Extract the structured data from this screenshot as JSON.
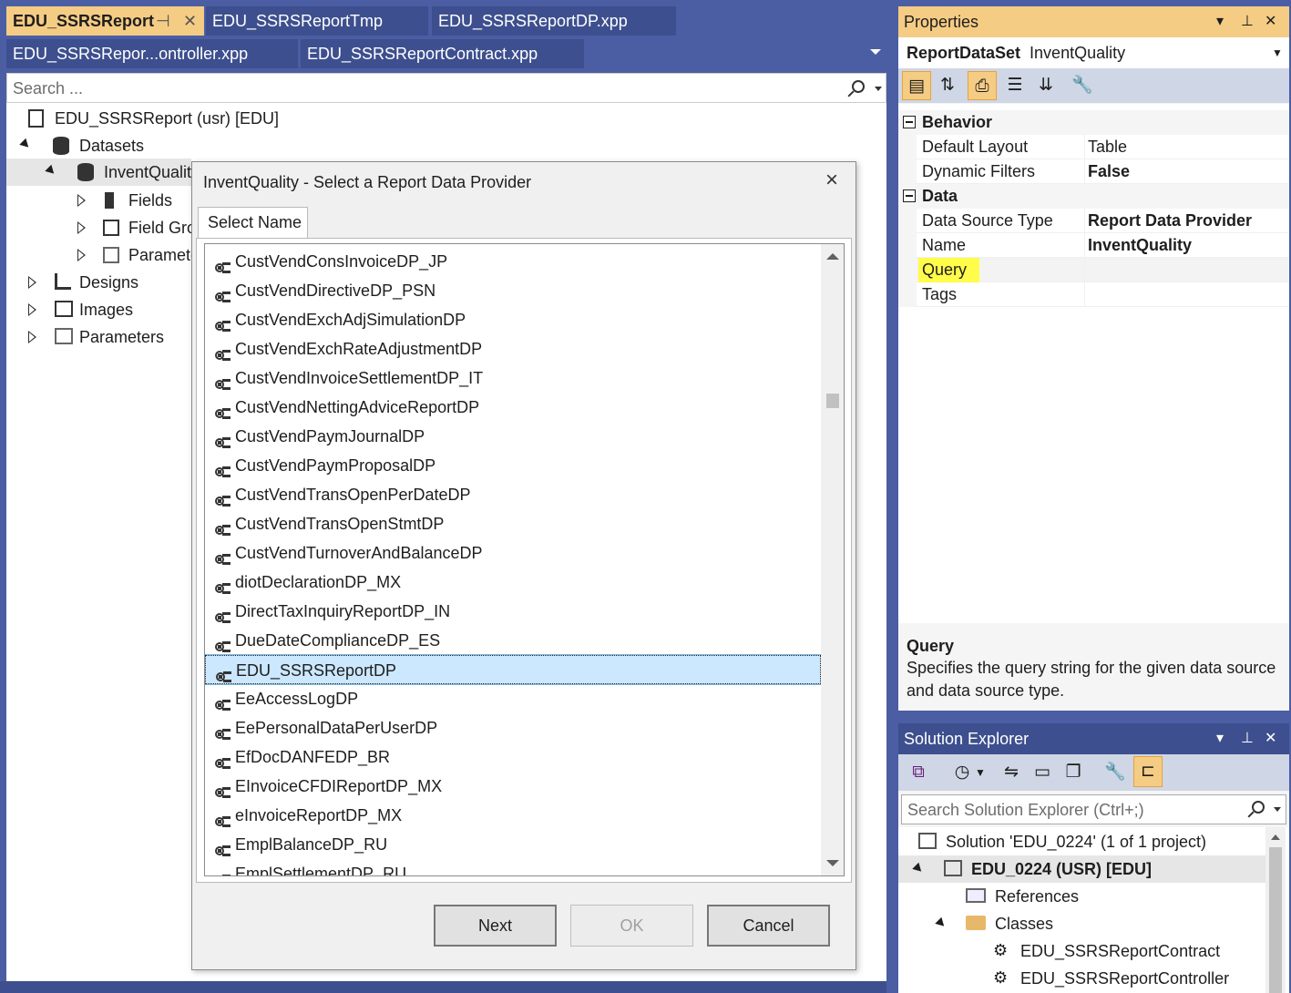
{
  "tabs": [
    {
      "label": "EDU_SSRSReport",
      "active": true
    },
    {
      "label": "EDU_SSRSReportTmp",
      "active": false
    },
    {
      "label": "EDU_SSRSReportDP.xpp",
      "active": false
    },
    {
      "label": "EDU_SSRSRepor...ontroller.xpp",
      "active": false
    },
    {
      "label": "EDU_SSRSReportContract.xpp",
      "active": false
    }
  ],
  "designer": {
    "search_placeholder": "Search ...",
    "tree": {
      "root": "EDU_SSRSReport (usr) [EDU]",
      "datasets": "Datasets",
      "dataset_item": "InventQualit",
      "fields": "Fields",
      "field_groups": "Field Gro",
      "parameters_child": "Paramete",
      "designs": "Designs",
      "images": "Images",
      "parameters": "Parameters"
    }
  },
  "dialog": {
    "title": "InventQuality - Select a Report Data Provider",
    "tab_label": "Select Name",
    "items": [
      "CustVendConsInvoiceDP_JP",
      "CustVendDirectiveDP_PSN",
      "CustVendExchAdjSimulationDP",
      "CustVendExchRateAdjustmentDP",
      "CustVendInvoiceSettlementDP_IT",
      "CustVendNettingAdviceReportDP",
      "CustVendPaymJournalDP",
      "CustVendPaymProposalDP",
      "CustVendTransOpenPerDateDP",
      "CustVendTransOpenStmtDP",
      "CustVendTurnoverAndBalanceDP",
      "diotDeclarationDP_MX",
      "DirectTaxInquiryReportDP_IN",
      "DueDateComplianceDP_ES",
      "EDU_SSRSReportDP",
      "EeAccessLogDP",
      "EePersonalDataPerUserDP",
      "EfDocDANFEDP_BR",
      "EInvoiceCFDIReportDP_MX",
      "eInvoiceReportDP_MX",
      "EmplBalanceDP_RU",
      "EmplSettlementDP_RU"
    ],
    "selected_item": "EDU_SSRSReportDP",
    "buttons": {
      "next": "Next",
      "ok": "OK",
      "cancel": "Cancel"
    }
  },
  "properties": {
    "title": "Properties",
    "object_type": "ReportDataSet",
    "object_name": "InventQuality",
    "categories": [
      {
        "name": "Behavior",
        "rows": [
          {
            "name": "Default Layout",
            "value": "Table",
            "bold": false
          },
          {
            "name": "Dynamic Filters",
            "value": "False",
            "bold": true
          }
        ]
      },
      {
        "name": "Data",
        "rows": [
          {
            "name": "Data Source Type",
            "value": "Report Data Provider",
            "bold": true
          },
          {
            "name": "Name",
            "value": "InventQuality",
            "bold": true
          },
          {
            "name": "Query",
            "value": "",
            "bold": false
          },
          {
            "name": "Tags",
            "value": "",
            "bold": false
          }
        ]
      }
    ],
    "description_title": "Query",
    "description_text": "Specifies the query string for the given data source and data source type."
  },
  "solution_explorer": {
    "title": "Solution Explorer",
    "search_placeholder": "Search Solution Explorer (Ctrl+;)",
    "tree": {
      "solution": "Solution 'EDU_0224' (1 of 1 project)",
      "project": "EDU_0224 (USR) [EDU]",
      "references": "References",
      "classes": "Classes",
      "class_items": [
        "EDU_SSRSReportContract",
        "EDU_SSRSReportController"
      ]
    }
  },
  "colors": {
    "background": "#4b5ea3",
    "active_tab": "#f5cc84",
    "inactive_tab": "#3d4f8e",
    "selection": "#cce8ff",
    "highlight": "#fffc4a"
  }
}
